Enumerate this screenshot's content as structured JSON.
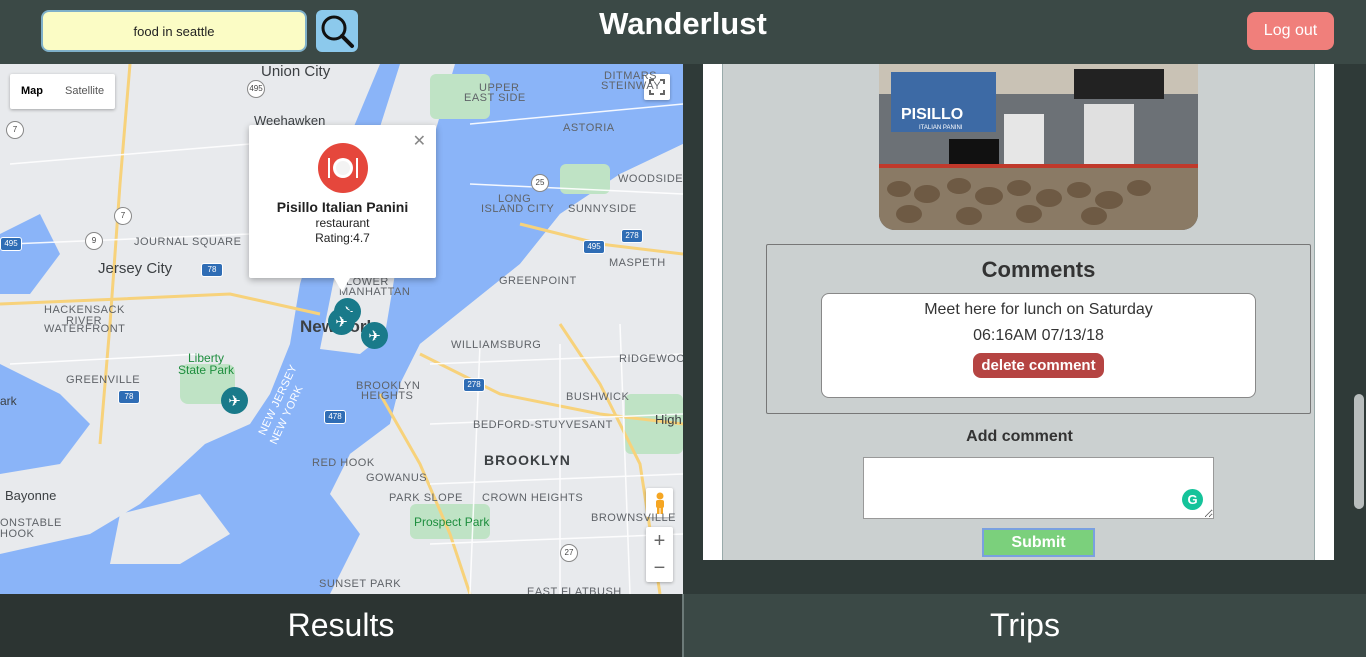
{
  "header": {
    "search_value": "food in seattle",
    "title": "Wanderlust",
    "logout_label": "Log out"
  },
  "map": {
    "type_map": "Map",
    "type_satellite": "Satellite",
    "zoom_in": "+",
    "zoom_out": "−",
    "labels": {
      "union_city": "Union City",
      "weehawken": "Weehawken",
      "journal_square": "JOURNAL SQUARE",
      "jersey_city": "Jersey City",
      "hackensack": "HACKENSACK",
      "river": "RIVER",
      "waterfront": "WATERFRONT",
      "greenville": "GREENVILLE",
      "liberty": "Liberty",
      "state_park": "State Park",
      "new_york": "New York",
      "manhattan": "MANHATTAN",
      "lower": "LOWER",
      "ditmars": "DITMARS",
      "steinway": "STEINWAY",
      "upper_east": "UPPER",
      "east_side": "EAST SIDE",
      "astoria": "ASTORIA",
      "woodside": "WOODSIDE",
      "long": "LONG",
      "island_city": "ISLAND CITY",
      "sunnyside": "SUNNYSIDE",
      "maspeth": "MASPETH",
      "greenpoint": "GREENPOINT",
      "williamsburg": "WILLIAMSBURG",
      "ridgewood": "RIDGEWOOD",
      "brooklyn_heights": "BROOKLYN",
      "heights": "HEIGHTS",
      "bushwick": "BUSHWICK",
      "bedford": "BEDFORD-STUYVESANT",
      "brooklyn": "BROOKLYN",
      "red_hook": "RED HOOK",
      "gowanus": "GOWANUS",
      "park_slope": "PARK SLOPE",
      "crown_heights": "CROWN HEIGHTS",
      "brownsville": "BROWNSVILLE",
      "prospect_park": "Prospect Park",
      "sunset_park": "SUNSET PARK",
      "east_flatbush": "EAST FLATBUSH",
      "bayonne": "Bayonne",
      "constable": "ONSTABLE",
      "hook": "HOOK",
      "ark": "ark",
      "high": "High",
      "new_jersey": "NEW JERSEY",
      "new_york_state": "NEW YORK"
    },
    "shields": [
      "495",
      "7",
      "7",
      "9",
      "78",
      "25",
      "495",
      "278",
      "278",
      "478",
      "27",
      "78",
      "495",
      "7"
    ],
    "info_window": {
      "name": "Pisillo Italian Panini",
      "type": "restaurant",
      "rating": "Rating:4.7"
    }
  },
  "trip": {
    "comments_title": "Comments",
    "comments": [
      {
        "text": "Meet here for lunch on Saturday",
        "time": "06:16AM 07/13/18",
        "delete_label": "delete comment"
      }
    ],
    "photo_sign": "PISILLO",
    "photo_sub": "ITALIAN PANINI",
    "add_comment_label": "Add comment",
    "submit_label": "Submit"
  },
  "tabs": {
    "results": "Results",
    "trips": "Trips"
  },
  "colors": {
    "header": "#3b4946",
    "accent_marker": "#197a8a",
    "logout": "#f07f7b",
    "delete": "#b54442",
    "submit": "#7bd07c",
    "water": "#8ab4f8"
  }
}
